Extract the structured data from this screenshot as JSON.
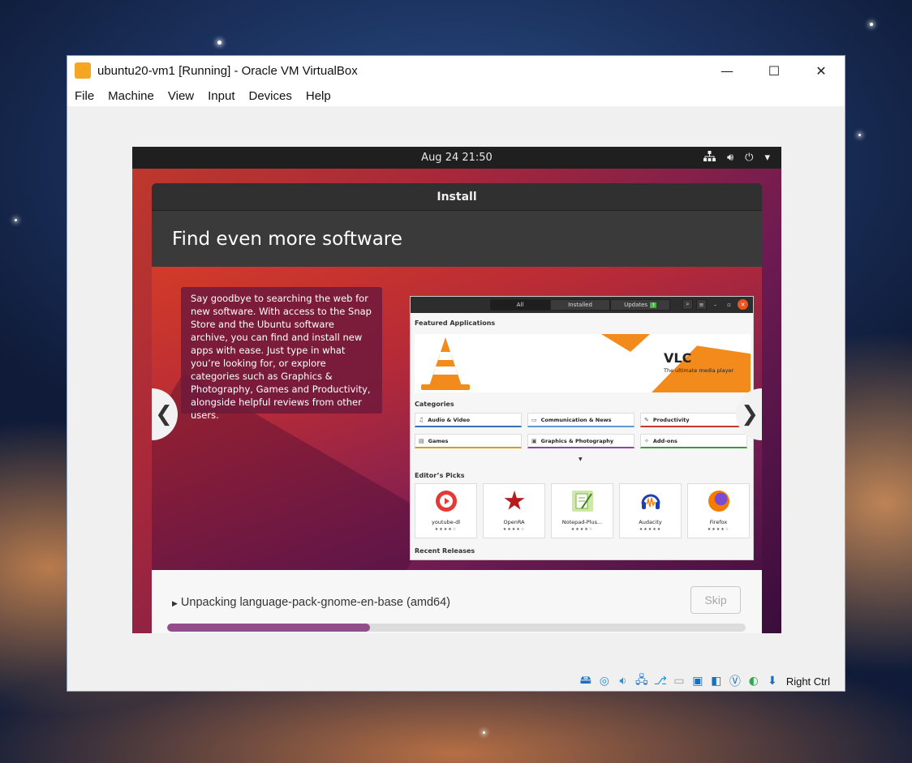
{
  "window": {
    "title": "ubuntu20-vm1 [Running] - Oracle VM VirtualBox",
    "controls": {
      "minimize": "—",
      "maximize": "☐",
      "close": "✕"
    }
  },
  "menubar": {
    "items": [
      "File",
      "Machine",
      "View",
      "Input",
      "Devices",
      "Help"
    ]
  },
  "vm": {
    "topbar": {
      "clock": "Aug 24  21:50"
    },
    "dialog": {
      "title": "Install",
      "heading": "Find even more software",
      "slide_text": "Say goodbye to searching the web for new software. With access to the Snap Store and the Ubuntu software archive, you can find and install new apps with ease. Just type in what you’re looking for, or explore categories such as Graphics & Photography, Games and Productivity, alongside helpful reviews from other users.",
      "prev_arrow": "❮",
      "next_arrow": "❯",
      "status_text": "Unpacking language-pack-gnome-en-base (amd64)",
      "skip_label": "Skip",
      "progress_fraction": 0.35
    },
    "software_center": {
      "tabs": [
        "All",
        "Installed",
        "Updates"
      ],
      "updates_badge": "3",
      "featured_title": "Featured Applications",
      "banner_title": "VLC",
      "banner_subtitle": "The ultimate media player",
      "categories_title": "Categories",
      "categories": [
        {
          "label": "Audio & Video",
          "icon": "music-icon",
          "color": "#3a6fb0"
        },
        {
          "label": "Communication & News",
          "icon": "chat-icon",
          "color": "#5a9bd4"
        },
        {
          "label": "Productivity",
          "icon": "edit-icon",
          "color": "#c0392b"
        },
        {
          "label": "Games",
          "icon": "game-icon",
          "color": "#d4a017"
        },
        {
          "label": "Graphics & Photography",
          "icon": "image-icon",
          "color": "#8e44ad"
        },
        {
          "label": "Add-ons",
          "icon": "puzzle-icon",
          "color": "#3c9a3c"
        }
      ],
      "editors_title": "Editor’s Picks",
      "picks": [
        {
          "name": "youtube-dl",
          "stars": "★★★★☆",
          "color": "#e53935"
        },
        {
          "name": "OpenRA",
          "stars": "★★★★☆",
          "color": "#b71c1c"
        },
        {
          "name": "Notepad-Plus...",
          "stars": "★★★★☆",
          "color": "#7cb342"
        },
        {
          "name": "Audacity",
          "stars": "★★★★★",
          "color": "#1e3fb3"
        },
        {
          "name": "Firefox",
          "stars": "★★★★☆",
          "color": "#f57c00"
        }
      ],
      "recent_title": "Recent Releases"
    }
  },
  "statusbar": {
    "host_key": "Right Ctrl"
  }
}
